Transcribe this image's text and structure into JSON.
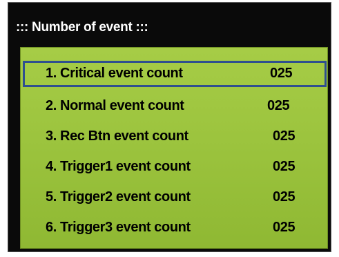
{
  "window": {
    "title": "::: Number of event :::"
  },
  "events": [
    {
      "label": "1. Critical event count",
      "value": "025",
      "selected": true
    },
    {
      "label": "2. Normal event count",
      "value": "025",
      "selected": false
    },
    {
      "label": "3. Rec Btn event count",
      "value": "025",
      "selected": false
    },
    {
      "label": "4. Trigger1 event count",
      "value": "025",
      "selected": false
    },
    {
      "label": "5. Trigger2 event count",
      "value": "025",
      "selected": false
    },
    {
      "label": "6. Trigger3 event count",
      "value": "025",
      "selected": false
    }
  ],
  "colors": {
    "background": "#0a0a0a",
    "panel": "#9cc43e",
    "selection_border": "#2f4f8f",
    "title_text": "#ffffff",
    "row_text": "#000000"
  }
}
